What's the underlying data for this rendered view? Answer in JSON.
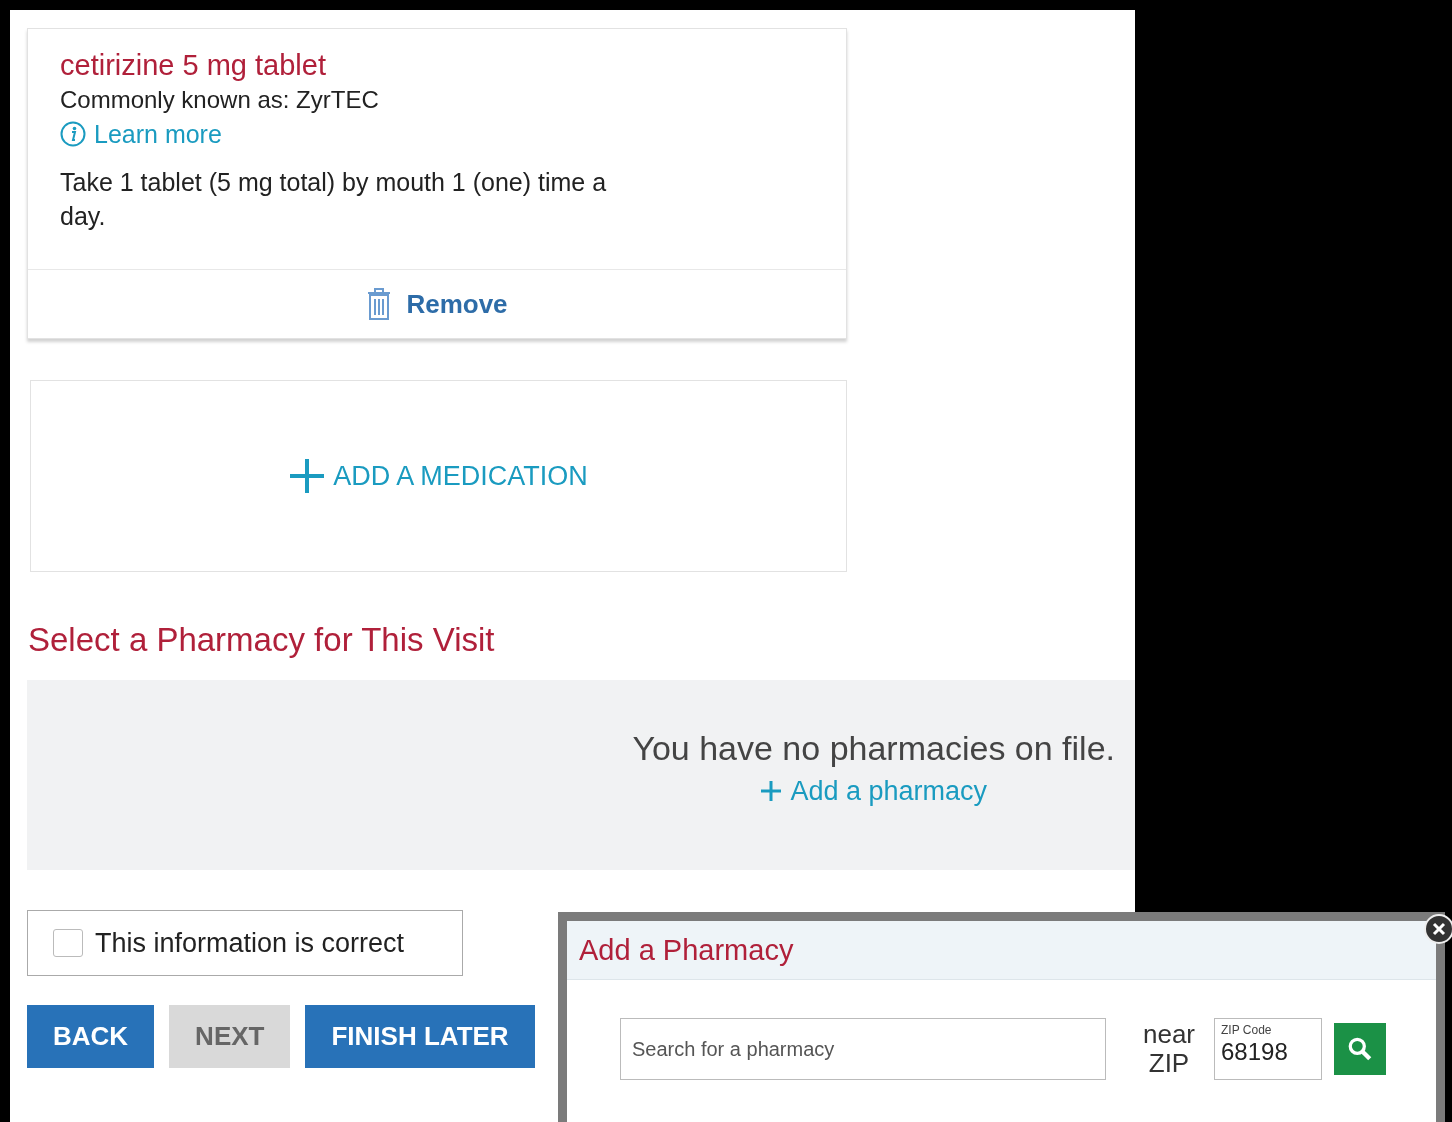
{
  "medication": {
    "name": "cetirizine 5 mg tablet",
    "known_as": "Commonly known as: ZyrTEC",
    "learn_more": "Learn more",
    "instructions": "Take 1 tablet (5 mg total) by mouth 1 (one) time a day.",
    "remove": "Remove"
  },
  "add_medication": {
    "label": "ADD A MEDICATION"
  },
  "pharmacy": {
    "heading": "Select a Pharmacy for This Visit",
    "empty_message": "You have no pharmacies on file.",
    "add_link": "Add a pharmacy"
  },
  "confirm": {
    "label": "This information is correct",
    "checked": false
  },
  "buttons": [
    {
      "label": "BACK",
      "disabled": false
    },
    {
      "label": "NEXT",
      "disabled": true
    },
    {
      "label": "FINISH LATER",
      "disabled": false
    }
  ],
  "dialog": {
    "title": "Add a Pharmacy",
    "search": {
      "placeholder": "Search for a pharmacy"
    },
    "near_label": "near ZIP",
    "zip": {
      "label": "ZIP Code",
      "value": "68198"
    }
  }
}
